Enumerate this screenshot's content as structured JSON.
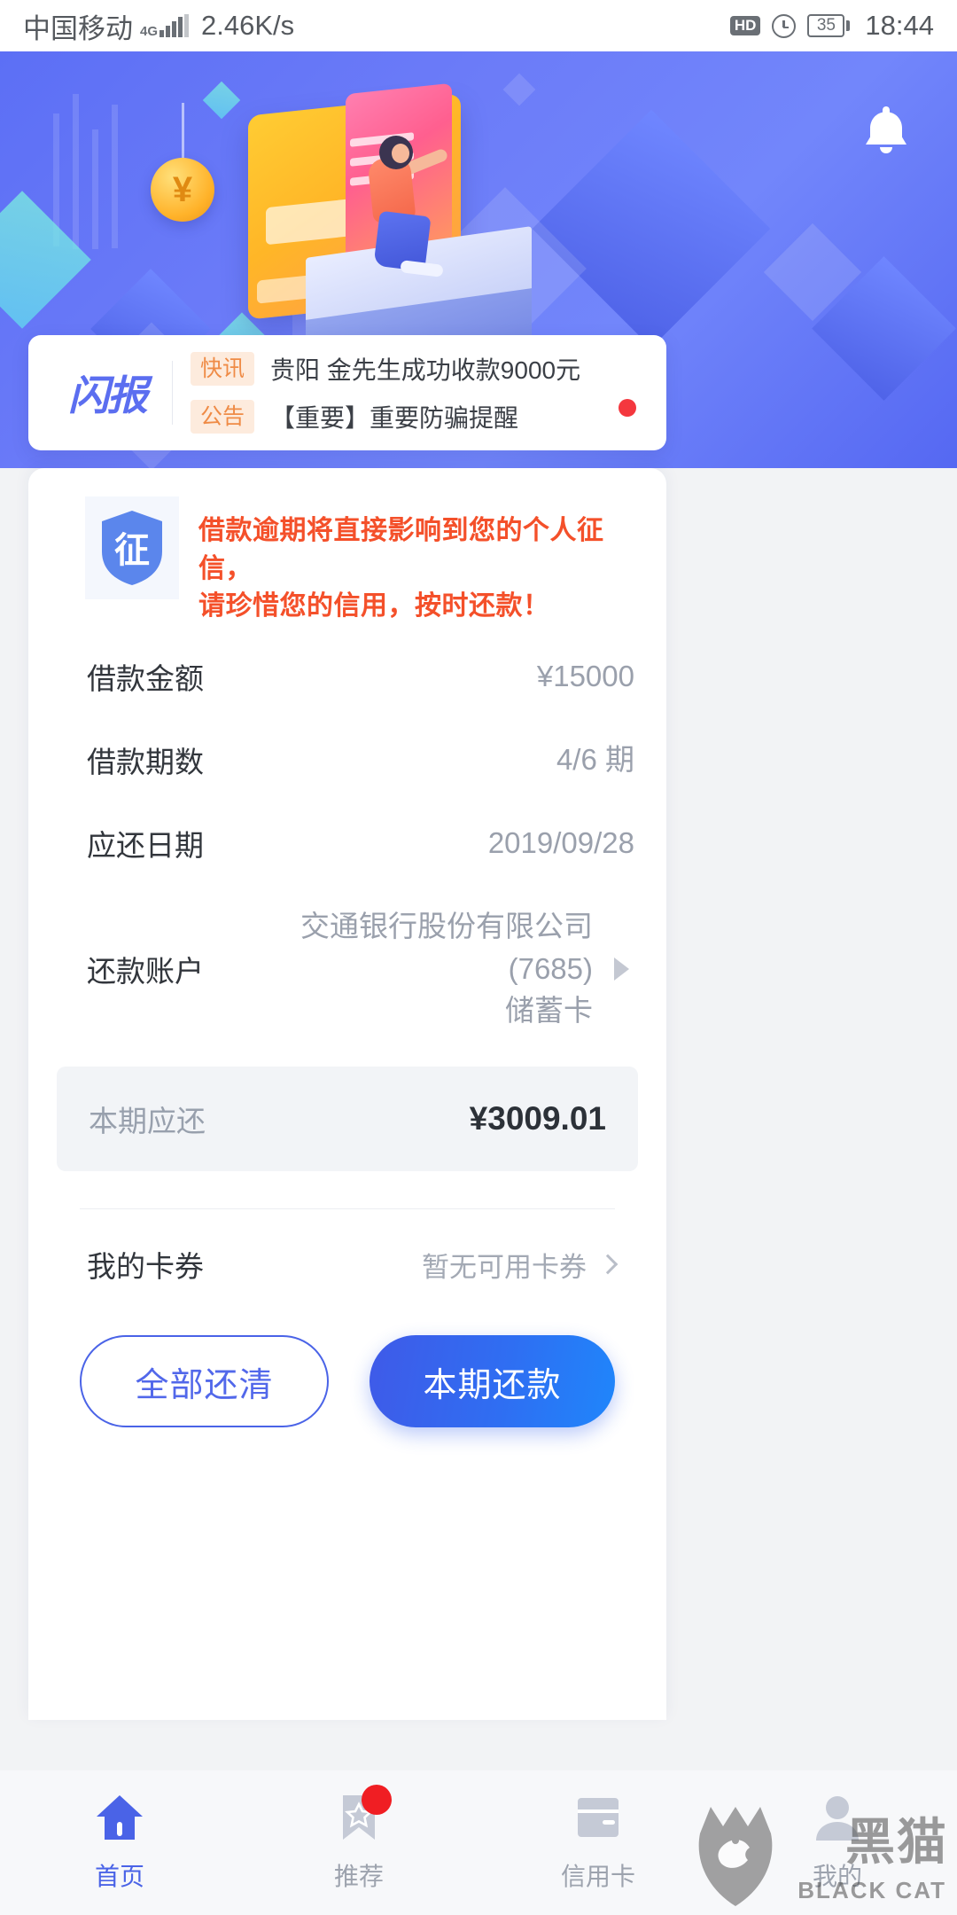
{
  "status_bar": {
    "carrier": "中国移动",
    "network_type": "4G",
    "speed": "2.46K/s",
    "hd_label": "HD",
    "alarm_icon": "alarm-clock-icon",
    "battery_level": "35",
    "time": "18:44"
  },
  "hero": {
    "bell_icon": "notification-bell-icon",
    "coin_symbol": "¥"
  },
  "news": {
    "logo_text": "闪报",
    "items": [
      {
        "tag": "快讯",
        "text": "贵阳 金先生成功收款9000元"
      },
      {
        "tag": "公告",
        "text": "【重要】重要防骗提醒"
      }
    ]
  },
  "repayment": {
    "shield_char": "征",
    "warning_line1": "借款逾期将直接影响到您的个人征信，",
    "warning_line2": "请珍惜您的信用，按时还款！",
    "rows": [
      {
        "label": "借款金额",
        "value": "¥15000"
      },
      {
        "label": "借款期数",
        "value": "4/6 期"
      },
      {
        "label": "应还日期",
        "value": "2019/09/28"
      }
    ],
    "account_label": "还款账户",
    "account_value": "交通银行股份有限公司(7685)",
    "account_value2": "储蓄卡",
    "due_label": "本期应还",
    "due_value": "¥3009.01",
    "coupon_label": "我的卡券",
    "coupon_value": "暂无可用卡券",
    "btn_payoff": "全部还清",
    "btn_pay_current": "本期还款"
  },
  "tabbar": {
    "items": [
      {
        "label": "首页",
        "icon": "home-icon",
        "active": true,
        "badge": false
      },
      {
        "label": "推荐",
        "icon": "bookmark-star-icon",
        "active": false,
        "badge": true
      },
      {
        "label": "信用卡",
        "icon": "credit-card-icon",
        "active": false,
        "badge": false
      },
      {
        "label": "我的",
        "icon": "person-icon",
        "active": false,
        "badge": false
      }
    ]
  },
  "watermark": {
    "text": "黑猫",
    "subtext": "BLACK CAT"
  },
  "colors": {
    "brand_blue": "#4a63e7",
    "warning_red": "#f4502a",
    "tag_orange": "#ef8b46",
    "badge_red": "#f01e23"
  }
}
